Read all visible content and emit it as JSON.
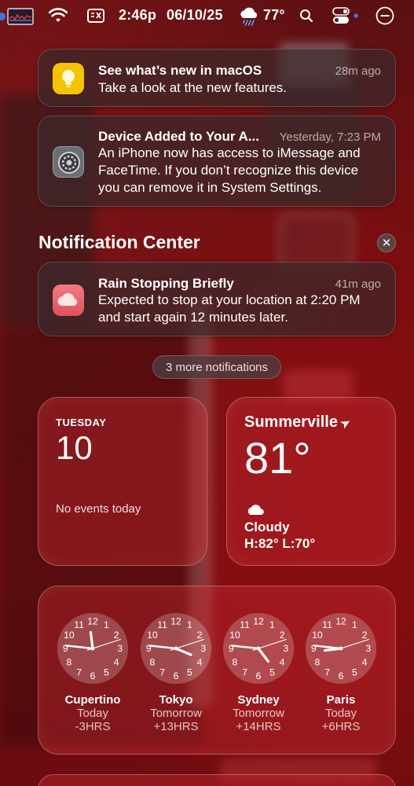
{
  "menubar": {
    "time": "2:46p",
    "date": "06/10/25",
    "temperature": "77°"
  },
  "notifications": [
    {
      "app_icon": "tips-lightbulb-icon",
      "title": "See what’s new in macOS",
      "time": "28m ago",
      "body": "Take a look at the new features."
    },
    {
      "app_icon": "system-settings-gear-icon",
      "title": "Device Added to Your A...",
      "time": "Yesterday, 7:23 PM",
      "body": "An iPhone now has access to iMessage and FaceTime. If you don’t recognize this device you can remove it in System Settings."
    }
  ],
  "notification_center": {
    "title": "Notification Center",
    "close_icon": "close-icon",
    "item": {
      "app_icon": "weather-cloud-icon",
      "title": "Rain Stopping Briefly",
      "time": "41m ago",
      "body": "Expected to stop at your location at 2:20 PM and start again 12 minutes later."
    },
    "more_label": "3 more notifications"
  },
  "calendar_widget": {
    "weekday": "TUESDAY",
    "day": "10",
    "events_text": "No events today"
  },
  "weather_widget": {
    "city": "Summerville",
    "temperature": "81°",
    "condition": "Cloudy",
    "hi_lo": "H:82° L:70°"
  },
  "world_clock_widget": {
    "clocks": [
      {
        "city": "Cupertino",
        "day": "Today",
        "offset": "-3HRS",
        "hour": 11,
        "minute": 46,
        "second": 12
      },
      {
        "city": "Tokyo",
        "day": "Tomorrow",
        "offset": "+13HRS",
        "hour": 3,
        "minute": 46,
        "second": 12
      },
      {
        "city": "Sydney",
        "day": "Tomorrow",
        "offset": "+14HRS",
        "hour": 4,
        "minute": 46,
        "second": 12
      },
      {
        "city": "Paris",
        "day": "Today",
        "offset": "+6HRS",
        "hour": 8,
        "minute": 46,
        "second": 12
      }
    ]
  },
  "colors": {
    "accent": "#c42830",
    "tips_yellow": "#f5c400",
    "weather_pink": "#e8616b",
    "clock_second_hand": "#ffffff"
  }
}
